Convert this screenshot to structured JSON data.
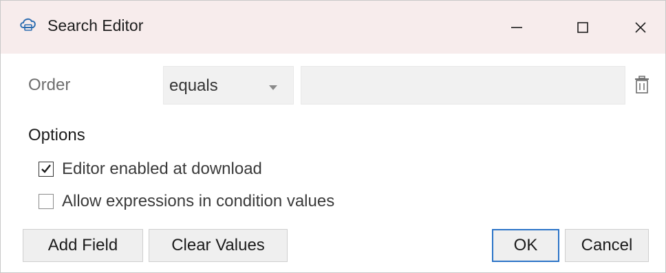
{
  "window": {
    "title": "Search Editor",
    "app_icon": "cloud-icon"
  },
  "controls": {
    "minimize": "minimize-icon",
    "maximize": "maximize-icon",
    "close": "close-icon"
  },
  "condition": {
    "field_label": "Order",
    "operator": "equals",
    "value": "",
    "delete_icon": "trash-icon"
  },
  "options": {
    "title": "Options",
    "items": [
      {
        "label": "Editor enabled at download",
        "checked": true
      },
      {
        "label": "Allow expressions in condition values",
        "checked": false
      }
    ]
  },
  "buttons": {
    "add_field": "Add Field",
    "clear_values": "Clear Values",
    "ok": "OK",
    "cancel": "Cancel"
  },
  "colors": {
    "titlebar": "#f7ecec",
    "accent": "#2a73c7"
  }
}
